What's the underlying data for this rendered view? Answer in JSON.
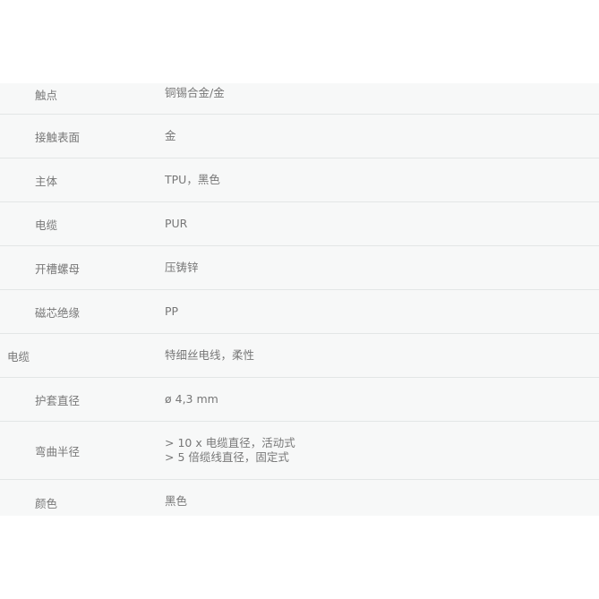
{
  "specs": [
    {
      "label": "触点",
      "value": [
        "铜锡合金/金"
      ]
    },
    {
      "label": "接触表面",
      "value": [
        "金"
      ]
    },
    {
      "label": "主体",
      "value": [
        "TPU，黑色"
      ]
    },
    {
      "label": "电缆",
      "value": [
        "PUR"
      ]
    },
    {
      "label": "开槽螺母",
      "value": [
        "压铸锌"
      ]
    },
    {
      "label": "磁芯绝缘",
      "value": [
        "PP"
      ]
    },
    {
      "label": "电缆",
      "value": [
        "特细丝电线，柔性"
      ]
    },
    {
      "label": "护套直径",
      "value": [
        "ø 4,3 mm"
      ]
    },
    {
      "label": "弯曲半径",
      "value": [
        "> 10 x 电缆直径，活动式",
        "> 5 倍缆线直径，固定式"
      ]
    },
    {
      "label": "颜色",
      "value": [
        "黑色"
      ]
    }
  ]
}
